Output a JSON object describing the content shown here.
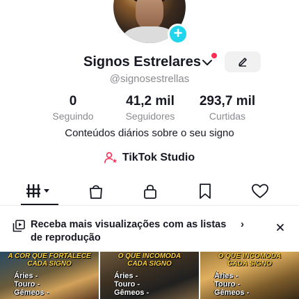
{
  "profile": {
    "name": "Signos Estrelares",
    "handle": "@signosestrellas",
    "bio": "Conteúdos diários sobre o seu signo"
  },
  "stats": [
    {
      "value": "0",
      "label": "Seguindo"
    },
    {
      "value": "41,2 mil",
      "label": "Seguidores"
    },
    {
      "value": "293,7 mil",
      "label": "Curtidas"
    }
  ],
  "studio": {
    "label": "TikTok Studio"
  },
  "tabs": [
    {
      "icon": "grid-icon",
      "active": true
    },
    {
      "icon": "shop-bag-icon",
      "active": false
    },
    {
      "icon": "lock-icon",
      "active": false
    },
    {
      "icon": "bookmark-icon",
      "active": false
    },
    {
      "icon": "heart-icon",
      "active": false
    }
  ],
  "banner": {
    "text": "Receba mais visualizações com as listas de reprodução",
    "arrow": "›"
  },
  "thumbnails": [
    {
      "headline_1": "A COR QUE FORTALECE",
      "headline_2": "CADA SIGNO",
      "items": [
        "Áries -",
        "Touro -",
        "Gêmeos -"
      ]
    },
    {
      "headline_1": "O QUE INCOMODA",
      "headline_2": "CADA SIGNO",
      "items": [
        "Áries -",
        "Touro -",
        "Gêmeos -"
      ]
    },
    {
      "headline_1": "O QUE INCOMODA",
      "headline_2": "CADA SIGNO",
      "items": [
        "Áries -",
        "Touro -",
        "Gêmeos -"
      ]
    }
  ],
  "colors": {
    "accent_cyan": "#20d5ec",
    "notification_red": "#fe2c55",
    "text_primary": "#161823",
    "text_secondary": "#8a8b91"
  }
}
